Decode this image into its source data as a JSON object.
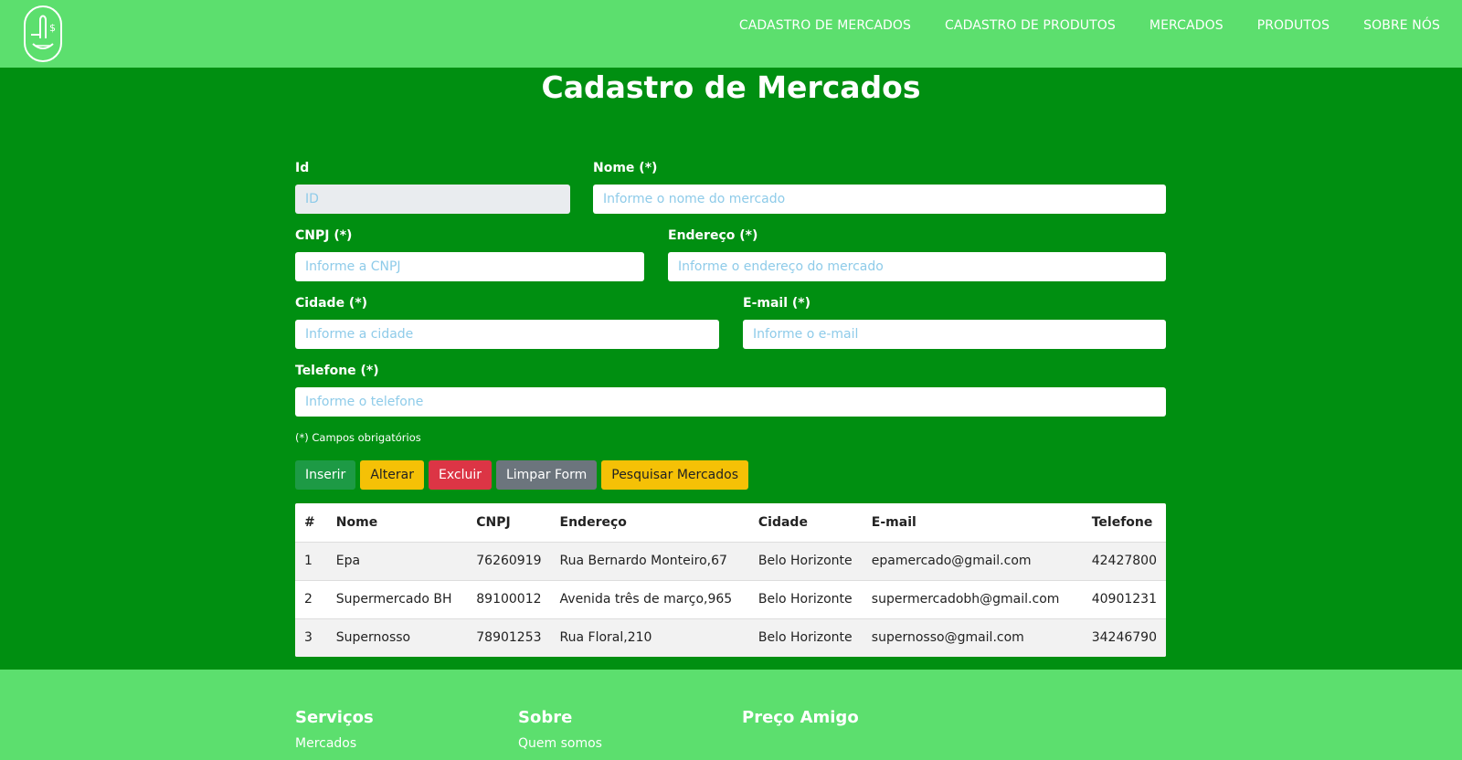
{
  "nav": {
    "items": [
      {
        "label": "CADASTRO DE MERCADOS"
      },
      {
        "label": "CADASTRO DE PRODUTOS"
      },
      {
        "label": "MERCADOS"
      },
      {
        "label": "PRODUTOS"
      },
      {
        "label": "SOBRE NÓS"
      }
    ]
  },
  "page": {
    "title": "Cadastro de Mercados"
  },
  "form": {
    "id": {
      "label": "Id",
      "placeholder": "ID",
      "value": ""
    },
    "nome": {
      "label": "Nome (*)",
      "placeholder": "Informe o nome do mercado",
      "value": ""
    },
    "cnpj": {
      "label": "CNPJ (*)",
      "placeholder": "Informe a CNPJ",
      "value": ""
    },
    "endereco": {
      "label": "Endereço (*)",
      "placeholder": "Informe o endereço do mercado",
      "value": ""
    },
    "cidade": {
      "label": "Cidade (*)",
      "placeholder": "Informe a cidade",
      "value": ""
    },
    "email": {
      "label": "E-mail (*)",
      "placeholder": "Informe o e-mail",
      "value": ""
    },
    "telefone": {
      "label": "Telefone (*)",
      "placeholder": "Informe o telefone",
      "value": ""
    },
    "required_note": "(*) Campos obrigatórios"
  },
  "buttons": {
    "inserir": "Inserir",
    "alterar": "Alterar",
    "excluir": "Excluir",
    "limpar": "Limpar Form",
    "pesquisar": "Pesquisar Mercados"
  },
  "table": {
    "headers": [
      "#",
      "Nome",
      "CNPJ",
      "Endereço",
      "Cidade",
      "E-mail",
      "Telefone"
    ],
    "rows": [
      [
        "1",
        "Epa",
        "76260919",
        "Rua Bernardo Monteiro,67",
        "Belo Horizonte",
        "epamercado@gmail.com",
        "42427800"
      ],
      [
        "2",
        "Supermercado BH",
        "89100012",
        "Avenida três de março,965",
        "Belo Horizonte",
        "supermercadobh@gmail.com",
        "40901231"
      ],
      [
        "3",
        "Supernosso",
        "78901253",
        "Rua Floral,210",
        "Belo Horizonte",
        "supernosso@gmail.com",
        "34246790"
      ]
    ]
  },
  "footer": {
    "servicos": {
      "title": "Serviços",
      "link": "Mercados"
    },
    "sobre": {
      "title": "Sobre",
      "link": "Quem somos"
    },
    "brand": {
      "title": "Preço Amigo"
    }
  },
  "colors": {
    "header_bg": "#5cdf6e",
    "page_bg": "#008f11",
    "success": "#1d9a45",
    "warning": "#f5c106",
    "danger": "#dc3545",
    "secondary": "#6c757d"
  }
}
